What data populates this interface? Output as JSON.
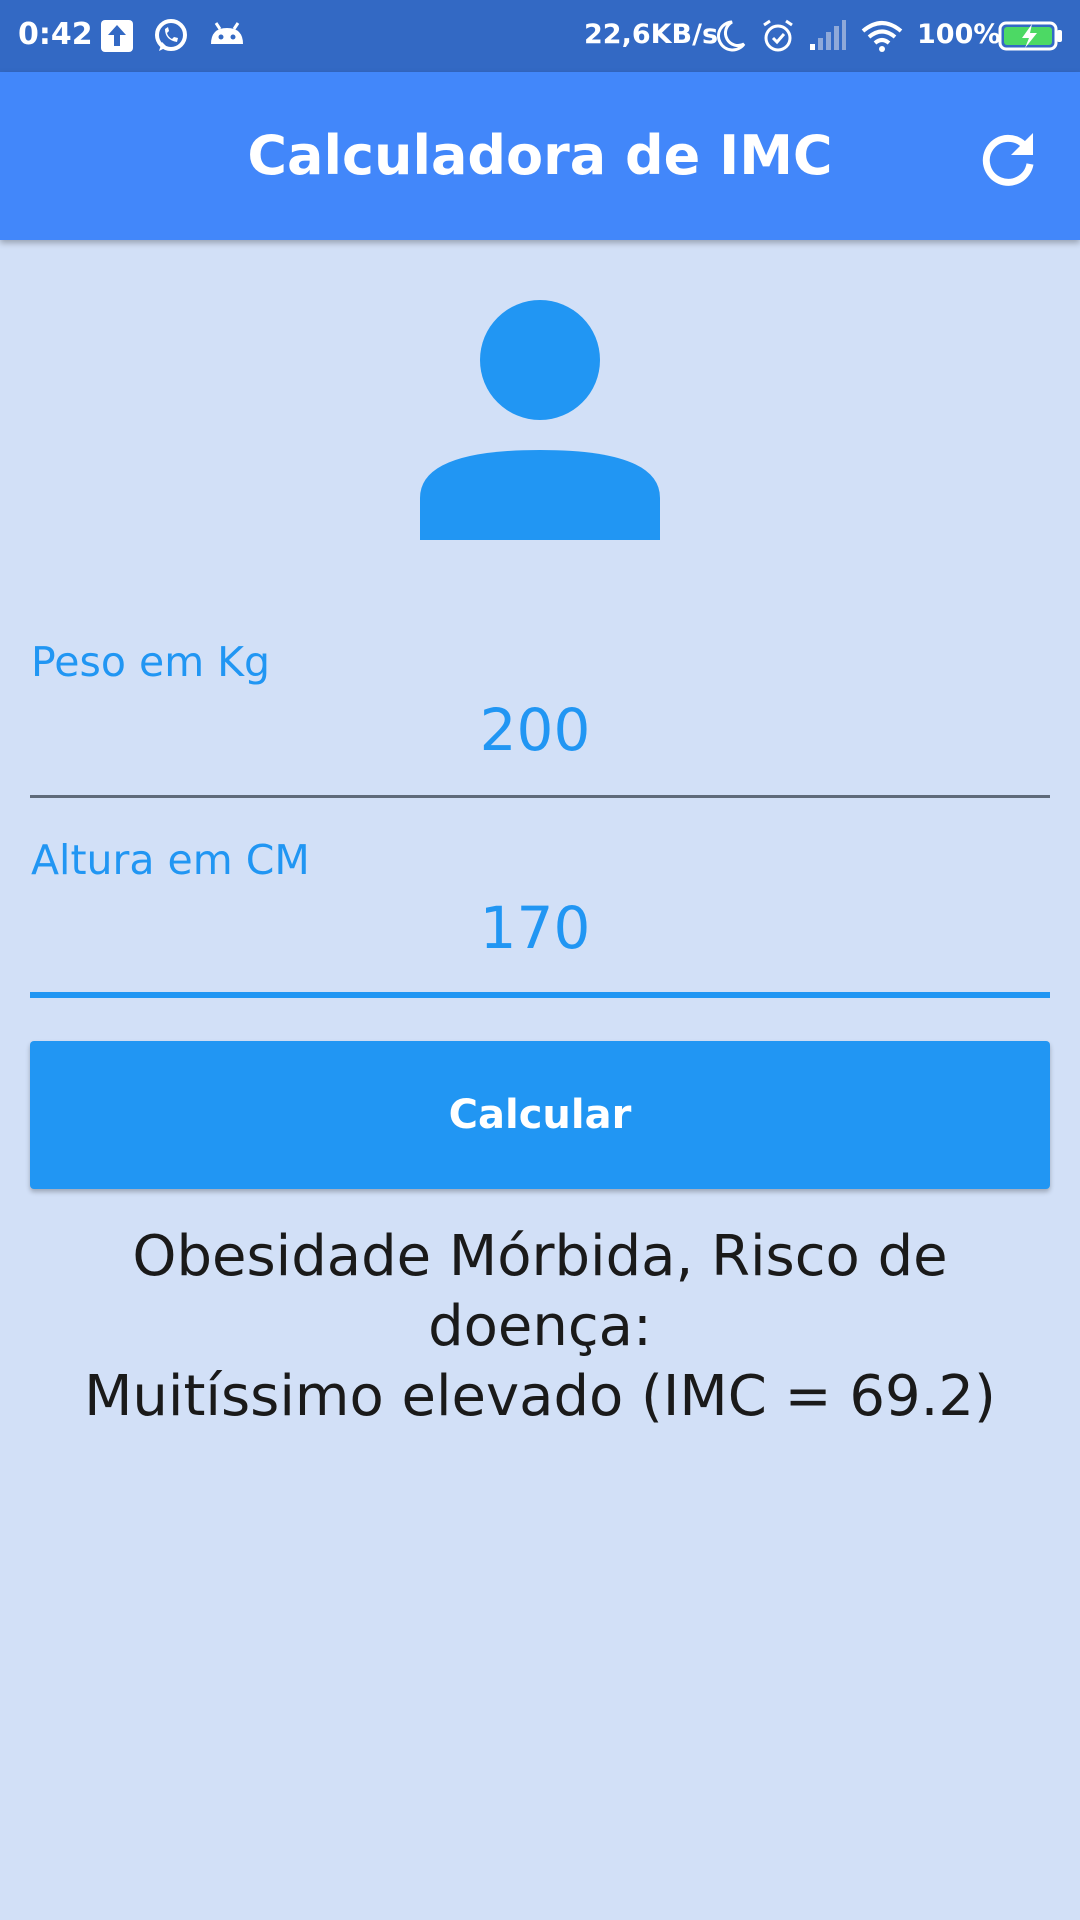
{
  "status_bar": {
    "time": "0:42",
    "network_speed": "22,6KB/s",
    "battery": "100%",
    "icons": [
      "upload-icon",
      "whatsapp-icon",
      "android-icon",
      "moon-icon",
      "alarm-icon",
      "signal-icon",
      "wifi-icon",
      "battery-charging-icon"
    ]
  },
  "app_bar": {
    "title": "Calculadora de IMC",
    "refresh_icon": "refresh-icon"
  },
  "avatar": {
    "icon": "person-icon"
  },
  "form": {
    "weight_label": "Peso em Kg",
    "weight_value": "200",
    "height_label": "Altura em CM",
    "height_value": "170"
  },
  "actions": {
    "calculate_label": "Calcular"
  },
  "result": {
    "line1": "Obesidade Mórbida, Risco de doença:",
    "line2": "Muitíssimo elevado (IMC = 69.2)"
  },
  "colors": {
    "status_bar": "#3369c4",
    "app_bar": "#4287fa",
    "background": "#d2e0f7",
    "accent": "#2196f3"
  }
}
